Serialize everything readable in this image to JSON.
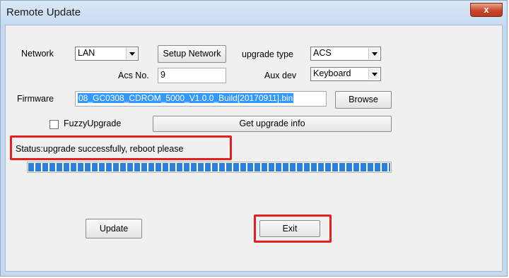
{
  "window": {
    "title": "Remote Update",
    "close_symbol": "x"
  },
  "network": {
    "label": "Network",
    "value": "LAN",
    "setup_button": "Setup Network"
  },
  "upgrade_type": {
    "label": "upgrade type",
    "value": "ACS"
  },
  "acs_no": {
    "label": "Acs No.",
    "value": "9"
  },
  "aux_dev": {
    "label": "Aux dev",
    "value": "Keyboard"
  },
  "firmware": {
    "label": "Firmware",
    "value": "08_GC0308_CDROM_5000_V1.0.0_Build[20170911].bin",
    "browse_button": "Browse"
  },
  "fuzzy_upgrade": {
    "label": "FuzzyUpgrade",
    "checked": false
  },
  "get_upgrade_info_button": "Get upgrade info",
  "status_text": "Status:upgrade successfully, reboot please",
  "progress": {
    "fraction": 1.0
  },
  "update_button": "Update",
  "exit_button": "Exit",
  "colors": {
    "highlight": "#e61e1e",
    "progress": "#2b80d8",
    "selection": "#3399ff"
  },
  "icons": {
    "close": "close-icon",
    "dropdown": "chevron-down-icon"
  }
}
